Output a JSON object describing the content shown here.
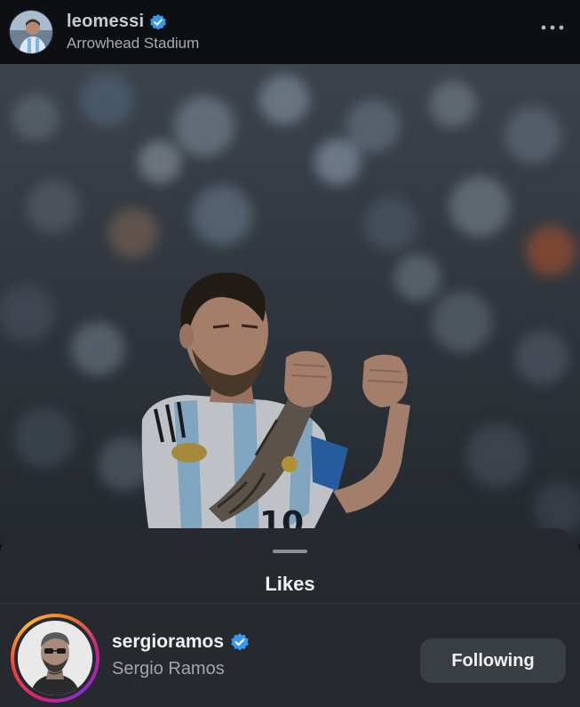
{
  "post": {
    "username": "leomessi",
    "location": "Arrowhead Stadium",
    "avatar_icon": "user-avatar",
    "more_icon": "more-horizontal-icon",
    "photo_icon": "post-photo-player-celebrating",
    "jersey_number": "10"
  },
  "likes_sheet": {
    "title": "Likes",
    "users": [
      {
        "username": "sergioramos",
        "full_name": "Sergio Ramos",
        "verified": true,
        "has_story": true,
        "follow_state": "Following"
      }
    ]
  },
  "colors": {
    "verified_blue": "#3897f0",
    "sheet_background": "#26292e",
    "button_background": "#393d44",
    "story_ring_start": "#f7b733",
    "story_ring_end": "#c41f8f"
  }
}
